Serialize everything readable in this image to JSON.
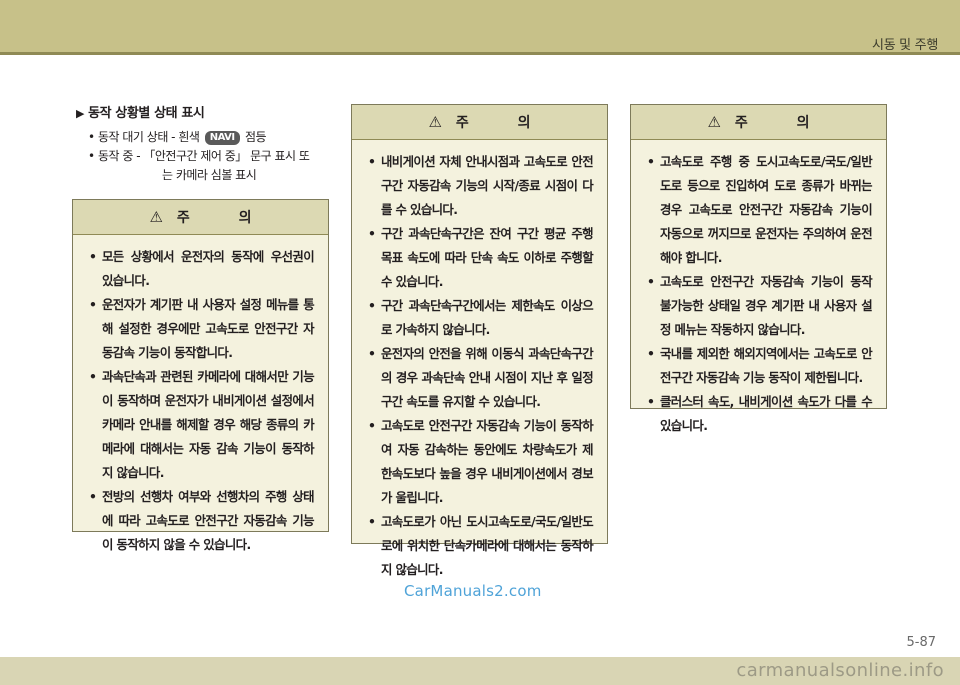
{
  "header": {
    "section_title": "시동 및 주행"
  },
  "heading": {
    "marker": "▶",
    "text": "동작 상황별 상태 표시"
  },
  "status_list": {
    "item1_before": "동작 대기 상태 - 흰색",
    "item1_badge": "NAVI",
    "item1_after": "점등",
    "item2_line1": "동작 중 - 「안전구간 제어 중」 문구 표시 또",
    "item2_line2": "는 카메라 심볼 표시"
  },
  "caution_icon": "warning-triangle-icon",
  "caution_title": "주 의",
  "caution_left": [
    "모든 상황에서 운전자의 동작에 우선권이 있습니다.",
    "운전자가 계기판 내 사용자 설정 메뉴를 통해 설정한 경우에만 고속도로 안전구간 자동감속 기능이 동작합니다.",
    "과속단속과 관련된 카메라에 대해서만 기능이 동작하며 운전자가 내비게이션 설정에서 카메라 안내를 해제할 경우 해당 종류의 카메라에 대해서는 자동 감속 기능이 동작하지 않습니다.",
    "전방의 선행차 여부와 선행차의 주행 상태에 따라 고속도로 안전구간 자동감속 기능이 동작하지 않을 수 있습니다."
  ],
  "caution_middle": [
    "내비게이션 자체 안내시점과 고속도로 안전구간 자동감속 기능의 시작/종료 시점이 다를 수 있습니다.",
    "구간 과속단속구간은 잔여 구간 평균 주행 목표 속도에 따라 단속 속도 이하로 주행할 수 있습니다.",
    "구간 과속단속구간에서는 제한속도 이상으로 가속하지 않습니다.",
    "운전자의 안전을 위해 이동식 과속단속구간의 경우 과속단속 안내 시점이 지난 후 일정구간 속도를 유지할 수 있습니다.",
    "고속도로 안전구간 자동감속 기능이 동작하여 자동 감속하는 동안에도 차량속도가 제한속도보다 높을 경우 내비게이션에서 경보가 울립니다.",
    "고속도로가 아닌 도시고속도로/국도/일반도로에 위치한 단속카메라에 대해서는 동작하지 않습니다."
  ],
  "caution_right": [
    "고속도로 주행 중 도시고속도로/국도/일반도로 등으로 진입하여 도로 종류가 바뀌는 경우 고속도로 안전구간 자동감속 기능이 자동으로 꺼지므로 운전자는 주의하여 운전해야 합니다.",
    "고속도로 안전구간 자동감속 기능이 동작 불가능한 상태일 경우 계기판 내 사용자 설정 메뉴는 작동하지 않습니다.",
    "국내를 제외한 해외지역에서는 고속도로 안전구간 자동감속 기능 동작이 제한됩니다.",
    "클러스터 속도, 내비게이션 속도가 다를 수 있습니다."
  ],
  "watermark": "CarManuals2.com",
  "page_number": "5-87",
  "footer": "carmanualsonline.info",
  "colors": {
    "band": "#c7c189",
    "caution_bg": "#f4f2de",
    "caution_header": "#dcd9b3"
  }
}
